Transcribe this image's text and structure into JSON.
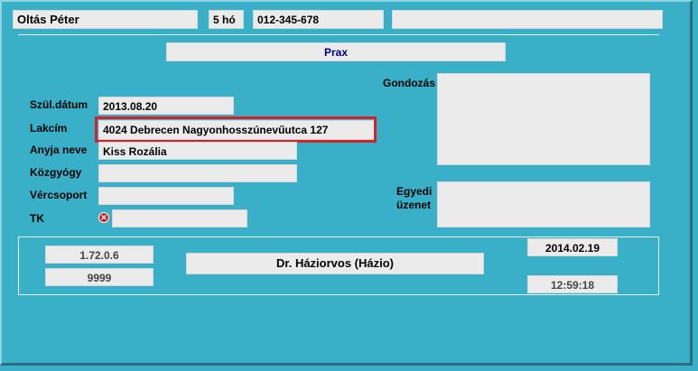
{
  "header": {
    "name": "Oltás Péter",
    "age": "5 hó",
    "phone": "012-345-678",
    "extra": ""
  },
  "prax": "Prax",
  "labels": {
    "birth_date": "Szül.dátum",
    "address": "Lakcím",
    "mother_name": "Anyja neve",
    "pharmacy": "Közgyógy",
    "blood_type": "Vércsoport",
    "tk": "TK",
    "care": "Gondozás",
    "unique_msg_line1": "Egyedi",
    "unique_msg_line2": "üzenet"
  },
  "fields": {
    "birth_date": "2013.08.20",
    "address": "4024 Debrecen Nagyonhosszúnevűutca 127",
    "mother_name": "Kiss Rozália",
    "pharmacy": "",
    "blood_type": "",
    "tk": "",
    "care": "",
    "unique_msg": ""
  },
  "footer": {
    "ip": "1.72.0.6",
    "code": "9999",
    "doctor": "Dr. Háziorvos (Házio)",
    "date": "2014.02.19",
    "time": "12:59:18"
  },
  "icons": {
    "tk_status": "error-x-icon"
  },
  "colors": {
    "background": "#3AAFC8",
    "field": "#EBEBEB",
    "highlight": "#D2232A",
    "prax_text": "#000080"
  }
}
